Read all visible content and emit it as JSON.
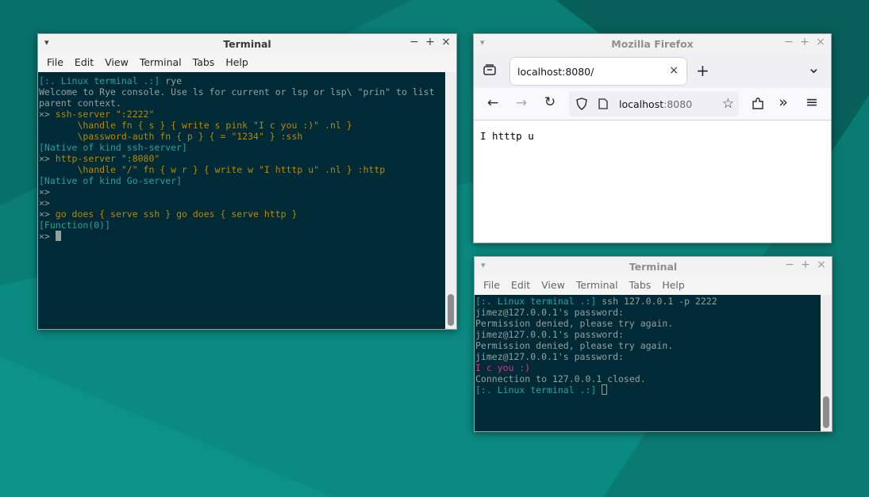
{
  "colors": {
    "desktop": "#0b8a80",
    "terminal_bg": "#002b36",
    "prompt": "#2aa198",
    "code": "#b58900",
    "pink": "#d33682",
    "text": "#93a1a1"
  },
  "window_controls": {
    "menu": "▾",
    "minimize": "−",
    "maximize": "+",
    "close": "×"
  },
  "terminal1": {
    "title": "Terminal",
    "menu": [
      "File",
      "Edit",
      "View",
      "Terminal",
      "Tabs",
      "Help"
    ],
    "lines": [
      [
        {
          "t": "[:. Linux terminal .:] ",
          "c": "cyan"
        },
        {
          "t": "rye",
          "c": "grey"
        }
      ],
      [
        {
          "t": "Welcome to Rye console. Use ls for current or lsp or lsp\\ \"prin\" to list",
          "c": "grey"
        }
      ],
      [
        {
          "t": "parent context.",
          "c": "grey"
        }
      ],
      [
        {
          "t": "×> ",
          "c": "grey"
        },
        {
          "t": "ssh-server \":2222\"",
          "c": "yellow"
        }
      ],
      [
        {
          "t": "       \\handle fn { s } { write s pink \"I c you :)\" .nl }",
          "c": "yellow"
        }
      ],
      [
        {
          "t": "       \\password-auth fn { p } { = \"1234\" } :ssh",
          "c": "yellow"
        }
      ],
      [
        {
          "t": "[Native of kind ssh-server]",
          "c": "cyan"
        }
      ],
      [
        {
          "t": "×> ",
          "c": "grey"
        },
        {
          "t": "http-server \":8080\"",
          "c": "yellow"
        }
      ],
      [
        {
          "t": "       \\handle \"/\" fn { w r } { write w \"I htttp u\" .nl } :http",
          "c": "yellow"
        }
      ],
      [
        {
          "t": "[Native of kind Go-server]",
          "c": "cyan"
        }
      ],
      [
        {
          "t": "×>",
          "c": "grey"
        }
      ],
      [
        {
          "t": "×>",
          "c": "grey"
        }
      ],
      [
        {
          "t": "×> ",
          "c": "grey"
        },
        {
          "t": "go does { serve ssh } go does { serve http }",
          "c": "yellow"
        }
      ],
      [
        {
          "t": "[Function(0)]",
          "c": "cyan"
        }
      ],
      [
        {
          "t": "×> ",
          "c": "grey"
        },
        {
          "cursor": "block"
        }
      ]
    ]
  },
  "firefox": {
    "title": "Mozilla Firefox",
    "tab_label": "localhost:8080/",
    "tab_close": "×",
    "new_tab": "+",
    "list_tabs": "⌄",
    "url": "localhost",
    "url_port": ":8080",
    "page_text": "I htttp u",
    "icons": {
      "back": "←",
      "forward": "→",
      "reload": "↻",
      "bookmark": "☆",
      "overflow": "»",
      "menu": "≡"
    }
  },
  "terminal2": {
    "title": "Terminal",
    "menu": [
      "File",
      "Edit",
      "View",
      "Terminal",
      "Tabs",
      "Help"
    ],
    "lines": [
      [
        {
          "t": "[:. Linux terminal .:] ",
          "c": "cyan"
        },
        {
          "t": "ssh 127.0.0.1 -p 2222",
          "c": "grey"
        }
      ],
      [
        {
          "t": "jimez@127.0.0.1's password:",
          "c": "grey"
        }
      ],
      [
        {
          "t": "Permission denied, please try again.",
          "c": "grey"
        }
      ],
      [
        {
          "t": "jimez@127.0.0.1's password:",
          "c": "grey"
        }
      ],
      [
        {
          "t": "Permission denied, please try again.",
          "c": "grey"
        }
      ],
      [
        {
          "t": "jimez@127.0.0.1's password:",
          "c": "grey"
        }
      ],
      [
        {
          "t": "I c you :)",
          "c": "magenta"
        }
      ],
      [
        {
          "t": "Connection to 127.0.0.1 closed.",
          "c": "grey"
        }
      ],
      [
        {
          "t": "[:. Linux terminal .:] ",
          "c": "cyan"
        },
        {
          "cursor": "outline"
        }
      ]
    ]
  }
}
